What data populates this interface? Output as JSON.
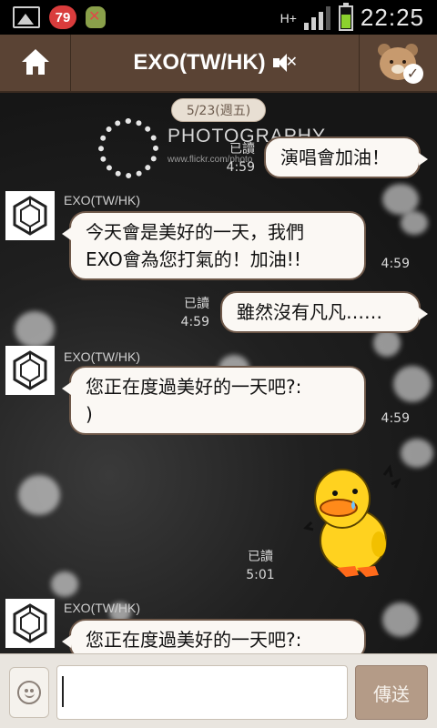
{
  "status_bar": {
    "notification_count": "79",
    "network": "H+",
    "clock": "22:25",
    "battery_level": 0.6
  },
  "header": {
    "title": "EXO(TW/HK)"
  },
  "chat": {
    "date_pill": "5/23(週五)",
    "background_watermark": {
      "brand": "PHOTOGRAPHY",
      "url": "www.flickr.com/photo"
    },
    "messages": [
      {
        "direction": "out",
        "text": "演唱會加油！",
        "read": "已讀",
        "time": "4:59"
      },
      {
        "direction": "in",
        "sender": "EXO(TW/HK)",
        "text": "今天會是美好的一天，我們\nEXO會為您打氣的！加油!!",
        "time": "4:59"
      },
      {
        "direction": "out",
        "text": "雖然沒有凡凡……",
        "read": "已讀",
        "time": "4:59"
      },
      {
        "direction": "in",
        "sender": "EXO(TW/HK)",
        "text": "您正在度過美好的一天吧?:\n)",
        "time": "4:59"
      },
      {
        "direction": "out",
        "sticker": "yellow-duck-sticker",
        "read": "已讀",
        "time": "5:01"
      },
      {
        "direction": "in",
        "sender": "EXO(TW/HK)",
        "text": "您正在度過美好的一天吧?:"
      }
    ]
  },
  "input_bar": {
    "message_value": "",
    "send_label": "傳送"
  },
  "colors": {
    "header_bg": "#5a4334",
    "bubble_bg": "#fbf8f4",
    "bubble_border": "#6e5849",
    "send_button": "#b49b87",
    "battery": "#8cd12e",
    "badge": "#d93c3c"
  }
}
